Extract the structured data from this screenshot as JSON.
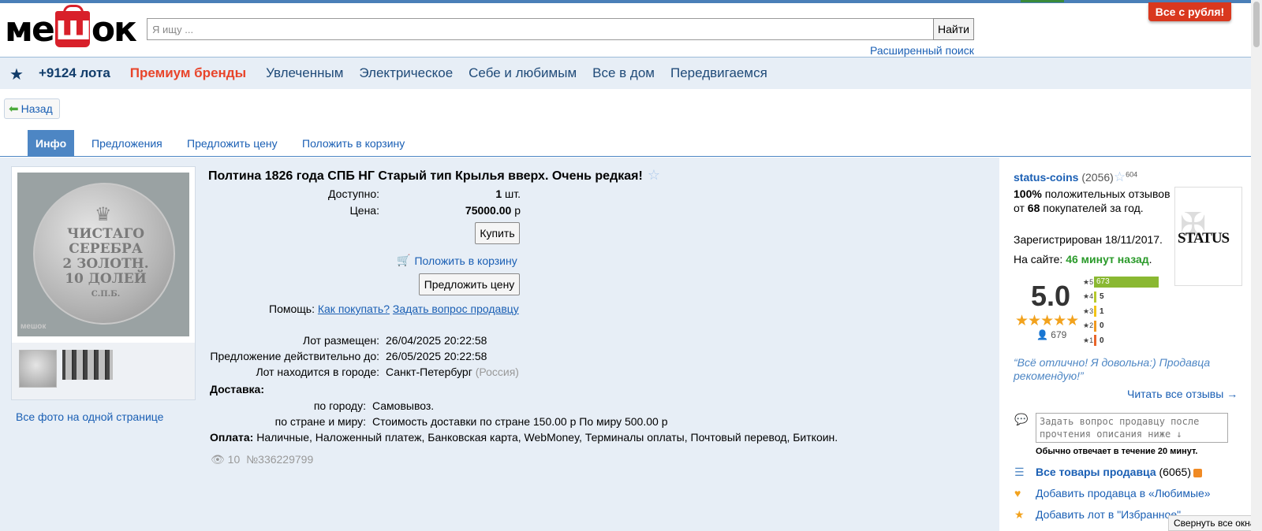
{
  "header": {
    "logo": {
      "left": "ме",
      "bag": "ш",
      "right": "ок"
    },
    "search_placeholder": "Я ищу ...",
    "search_button": "Найти",
    "advanced_search": "Расширенный поиск",
    "promo": "Все с рубля!"
  },
  "nav": {
    "lots": "+9124 лота",
    "premium": "Премиум бренды",
    "items": [
      "Увлеченным",
      "Электрическое",
      "Себе и любимым",
      "Все в дом",
      "Передвигаемся"
    ]
  },
  "back": "Назад",
  "tabs": [
    "Инфо",
    "Предложения",
    "Предложить цену",
    "Положить в корзину"
  ],
  "gallery": {
    "coin_text": [
      "ЧИСТАГО",
      "СЕРЕБРА",
      "2 ЗОЛОТН.",
      "10 ДОЛЕЙ",
      "С.П.Б."
    ],
    "watermark": "мешок",
    "all_photos": "Все фото на одной странице"
  },
  "lot": {
    "title": "Полтина 1826 года СПБ НГ Старый тип Крылья вверх. Очень редкая!",
    "available_label": "Доступно:",
    "available_value": "1",
    "available_unit": "шт.",
    "price_label": "Цена:",
    "price_value": "75000.00",
    "price_unit": "р",
    "buy_button": "Купить",
    "cart_link": "Положить в корзину",
    "offer_button": "Предложить цену",
    "help_label": "Помощь:",
    "help_link1": "Как покупать?",
    "help_link2": "Задать вопрос продавцу",
    "placed_label": "Лот размещен:",
    "placed_value": "26/04/2025 20:22:58",
    "valid_label": "Предложение действительно до:",
    "valid_value": "26/05/2025 20:22:58",
    "city_label": "Лот находится в городе:",
    "city_value": "Санкт-Петербург",
    "country": "(Россия)",
    "delivery_label": "Доставка:",
    "city_delivery_label": "по городу:",
    "city_delivery_value": "Самовывоз.",
    "world_delivery_label": "по стране и миру:",
    "world_delivery_value": "Стоимость доставки по стране 150.00 р По миру 500.00 р",
    "payment_label": "Оплата:",
    "payment_value": "Наличные, Наложенный платеж, Банковская карта, WebMoney, Терминалы оплаты, Почтовый перевод, Биткоин.",
    "views": "10",
    "lot_number": "№336229799"
  },
  "seller": {
    "name": "status-coins",
    "count": "(2056)",
    "fav_count": "604",
    "pos_pct": "100%",
    "pos_text1": "положительных отзывов от",
    "buyers": "68",
    "pos_text2": "покупателей за год.",
    "registered": "Зарегистрирован 18/11/2017.",
    "online_label": "На сайте:",
    "online_value": "46 минут назад",
    "logo_text": "STATUS",
    "score": "5.0",
    "score_count": "679",
    "bars": [
      {
        "star": "5",
        "value": 673,
        "color": "#8ab832"
      },
      {
        "star": "4",
        "value": 5,
        "color": "#b6c92e"
      },
      {
        "star": "3",
        "value": 1,
        "color": "#f2c417"
      },
      {
        "star": "2",
        "value": 0,
        "color": "#f09a1f"
      },
      {
        "star": "1",
        "value": 0,
        "color": "#e8652a"
      }
    ],
    "quote": "“Всё отлично! Я довольна:) Продавца рекомендую!”",
    "read_all": "Читать все отзывы →",
    "ask_placeholder": "Задать вопрос продавцу после прочтения описания ниже ↓",
    "response_time": "Обычно отвечает в течение 20 минут.",
    "all_items": "Все товары продавца",
    "all_items_count": "(6065)",
    "add_fav": "Добавить продавца в «Любимые»",
    "add_lot_fav": "Добавить лот в \"Избранное\""
  },
  "collapse_tip": "Свернуть все окна"
}
